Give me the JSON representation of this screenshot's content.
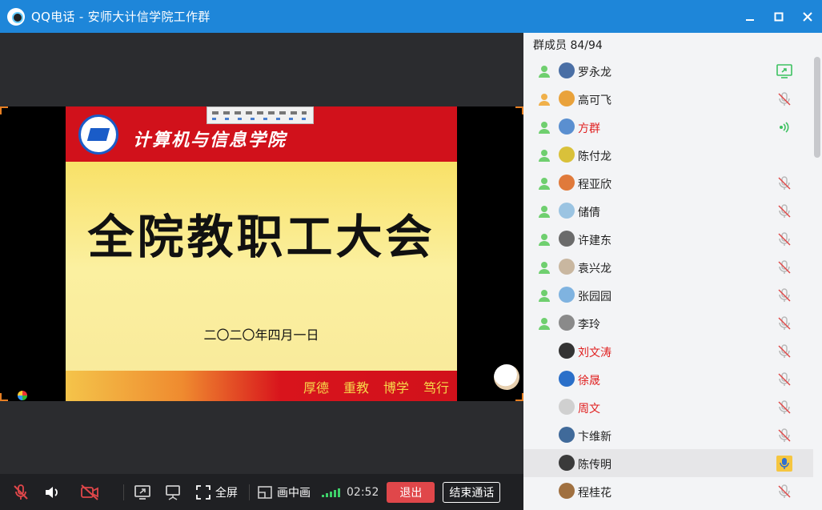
{
  "window": {
    "title": "QQ电话 - 安师大计信学院工作群",
    "controls": [
      "minimize-icon",
      "maximize-icon",
      "close-icon"
    ]
  },
  "slide": {
    "school": "计算机与信息学院",
    "title": "全院教职工大会",
    "date": "二〇二〇年四月一日",
    "motto": [
      "厚德",
      "重教",
      "博学",
      "笃行"
    ]
  },
  "controls": {
    "fullscreen_label": "全屏",
    "pip_label": "画中画",
    "timer": "02:52",
    "exit_label": "退出",
    "end_label": "结束通话"
  },
  "panel": {
    "header": "群成员 84/94",
    "members": [
      {
        "name": "罗永龙",
        "color": "normal",
        "status": "screen-share-icon"
      },
      {
        "name": "高可飞",
        "color": "normal",
        "status": "mic-muted-icon"
      },
      {
        "name": "方群",
        "color": "red",
        "status": "speaking-icon"
      },
      {
        "name": "陈付龙",
        "color": "normal",
        "status": ""
      },
      {
        "name": "程亚欣",
        "color": "normal",
        "status": "mic-muted-icon"
      },
      {
        "name": "储倩",
        "color": "normal",
        "status": "mic-muted-icon"
      },
      {
        "name": "许建东",
        "color": "normal",
        "status": "mic-muted-icon"
      },
      {
        "name": "袁兴龙",
        "color": "normal",
        "status": "mic-muted-icon"
      },
      {
        "name": "张园园",
        "color": "normal",
        "status": "mic-muted-icon"
      },
      {
        "name": "李玲",
        "color": "normal",
        "status": "mic-muted-icon"
      },
      {
        "name": "刘文涛",
        "color": "red",
        "status": "mic-muted-icon"
      },
      {
        "name": "徐晟",
        "color": "red",
        "status": "mic-muted-icon"
      },
      {
        "name": "周文",
        "color": "red",
        "status": "mic-muted-icon"
      },
      {
        "name": "卞维新",
        "color": "normal",
        "status": "mic-muted-icon"
      },
      {
        "name": "陈传明",
        "color": "normal",
        "status": "mic-active-icon"
      },
      {
        "name": "程桂花",
        "color": "normal",
        "status": "mic-muted-icon"
      }
    ]
  },
  "colors": {
    "titlebar": "#1e86d9",
    "exit_button": "#e0474a",
    "signal": "#3ed16a",
    "member_red": "#e02020"
  }
}
